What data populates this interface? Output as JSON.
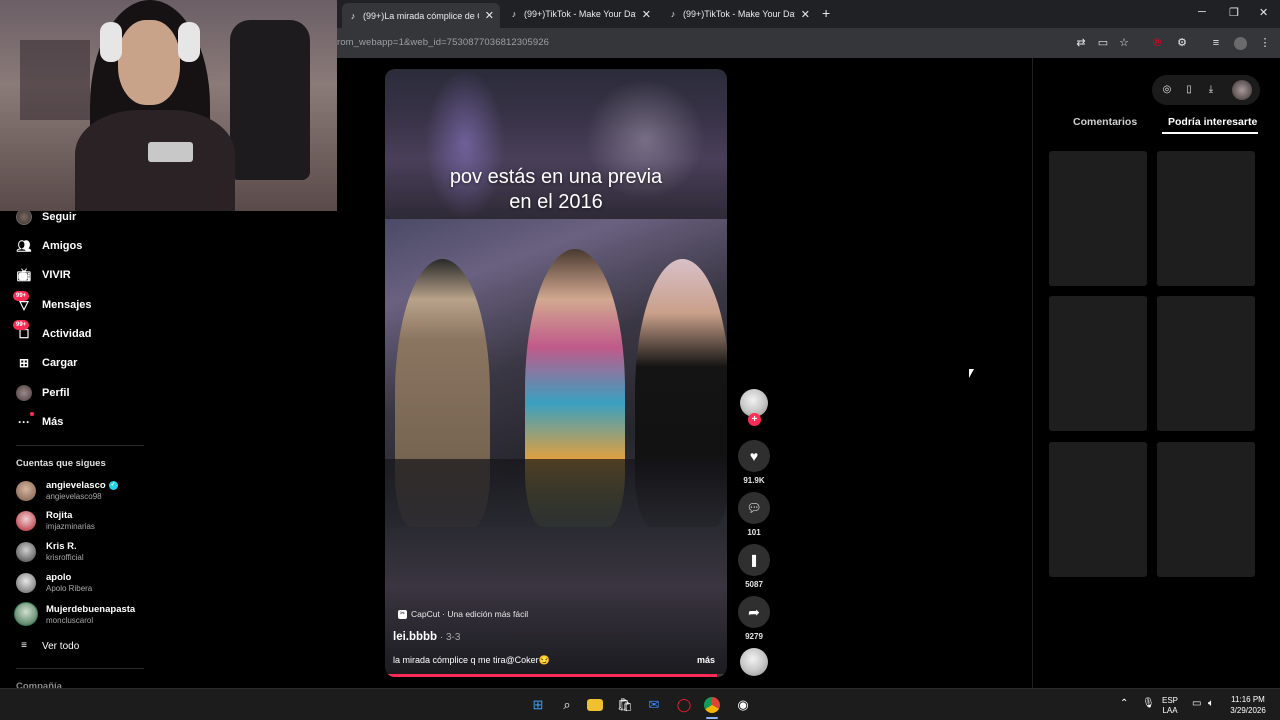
{
  "browser": {
    "tabs": [
      {
        "label": "(99+)La mirada cómplice de Co",
        "active": true
      },
      {
        "label": "(99+)TikTok - Make Your Day",
        "active": false
      },
      {
        "label": "(99+)TikTok - Make Your Day",
        "active": false
      }
    ],
    "url": "rom_webapp=1&web_id=7530877036812305926"
  },
  "sidebar": {
    "nav": [
      {
        "label": "Seguir",
        "icon": "following-avatar-icon"
      },
      {
        "label": "Amigos",
        "icon": "friends-icon"
      },
      {
        "label": "VIVIR",
        "icon": "live-icon"
      },
      {
        "label": "Mensajes",
        "icon": "messages-icon",
        "badge": "99+"
      },
      {
        "label": "Actividad",
        "icon": "activity-icon",
        "badge": "99+"
      },
      {
        "label": "Cargar",
        "icon": "upload-icon"
      },
      {
        "label": "Perfil",
        "icon": "profile-avatar-icon"
      },
      {
        "label": "Más",
        "icon": "more-icon"
      }
    ],
    "following_title": "Cuentas que sigues",
    "following": [
      {
        "name": "angievelasco",
        "handle": "angievelasco98",
        "verified": true
      },
      {
        "name": "Rojita",
        "handle": "imjazminarias"
      },
      {
        "name": "Kris R.",
        "handle": "krisrofficial"
      },
      {
        "name": "apolo",
        "handle": "Apolo Ribera"
      },
      {
        "name": "Mujerdebuenapasta",
        "handle": "moncluscarol"
      }
    ],
    "see_all": "Ver todo",
    "company": "Compañía"
  },
  "video": {
    "overlay_line1": "pov estás en una previa",
    "overlay_line2": "en el 2016",
    "capcut": "CapCut · Una edición más fácil",
    "author": "lei.bbbb",
    "date": " · 3-3",
    "caption": "la mirada cómplice q me tira@Coker😏",
    "more": "más",
    "progress": 0.97
  },
  "actions": {
    "likes": "91.9K",
    "comments": "101",
    "saves": "5087",
    "shares": "9279"
  },
  "right_panel": {
    "tabs": [
      "Comentarios",
      "Podría interesarte"
    ],
    "active_tab": "Podría interesarte"
  },
  "taskbar": {
    "lang1": "ESP",
    "lang2": "LAA",
    "time": "11:16 PM",
    "date": "3/29/2026"
  },
  "colors": {
    "accent": "#fe2c55",
    "verified": "#20d5ec"
  }
}
